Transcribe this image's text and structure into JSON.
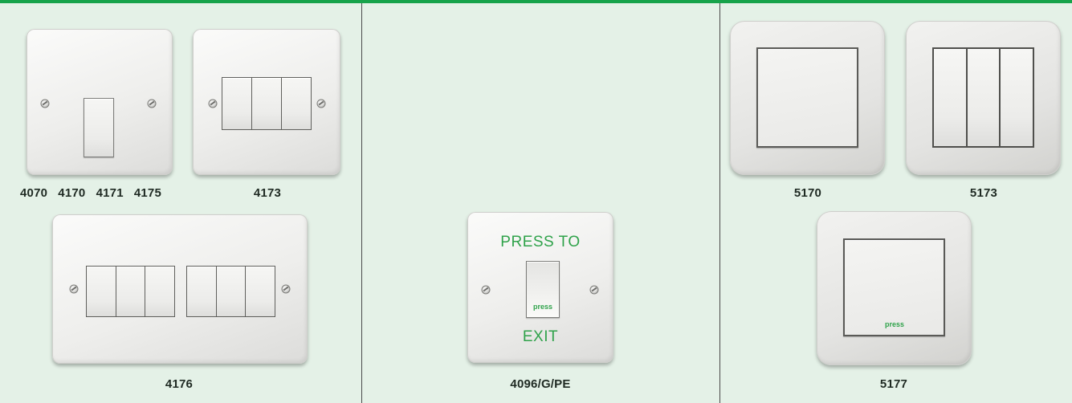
{
  "labels": {
    "single_switch_codes": [
      "4070",
      "4170",
      "4171",
      "4175"
    ],
    "triple_switch": "4173",
    "six_gang_switch": "4176",
    "exit_switch": "4096/G/PE",
    "square_single": "5170",
    "square_triple": "5173",
    "square_press": "5177"
  },
  "exit_plate": {
    "top_text": "PRESS TO",
    "bottom_text": "EXIT",
    "rocker_text": "press"
  },
  "square_press_plate": {
    "rocker_text": "press"
  },
  "colors": {
    "accent_bar": "#16a34a",
    "background": "#e4f1e7",
    "legend_green": "#2fa24a"
  }
}
